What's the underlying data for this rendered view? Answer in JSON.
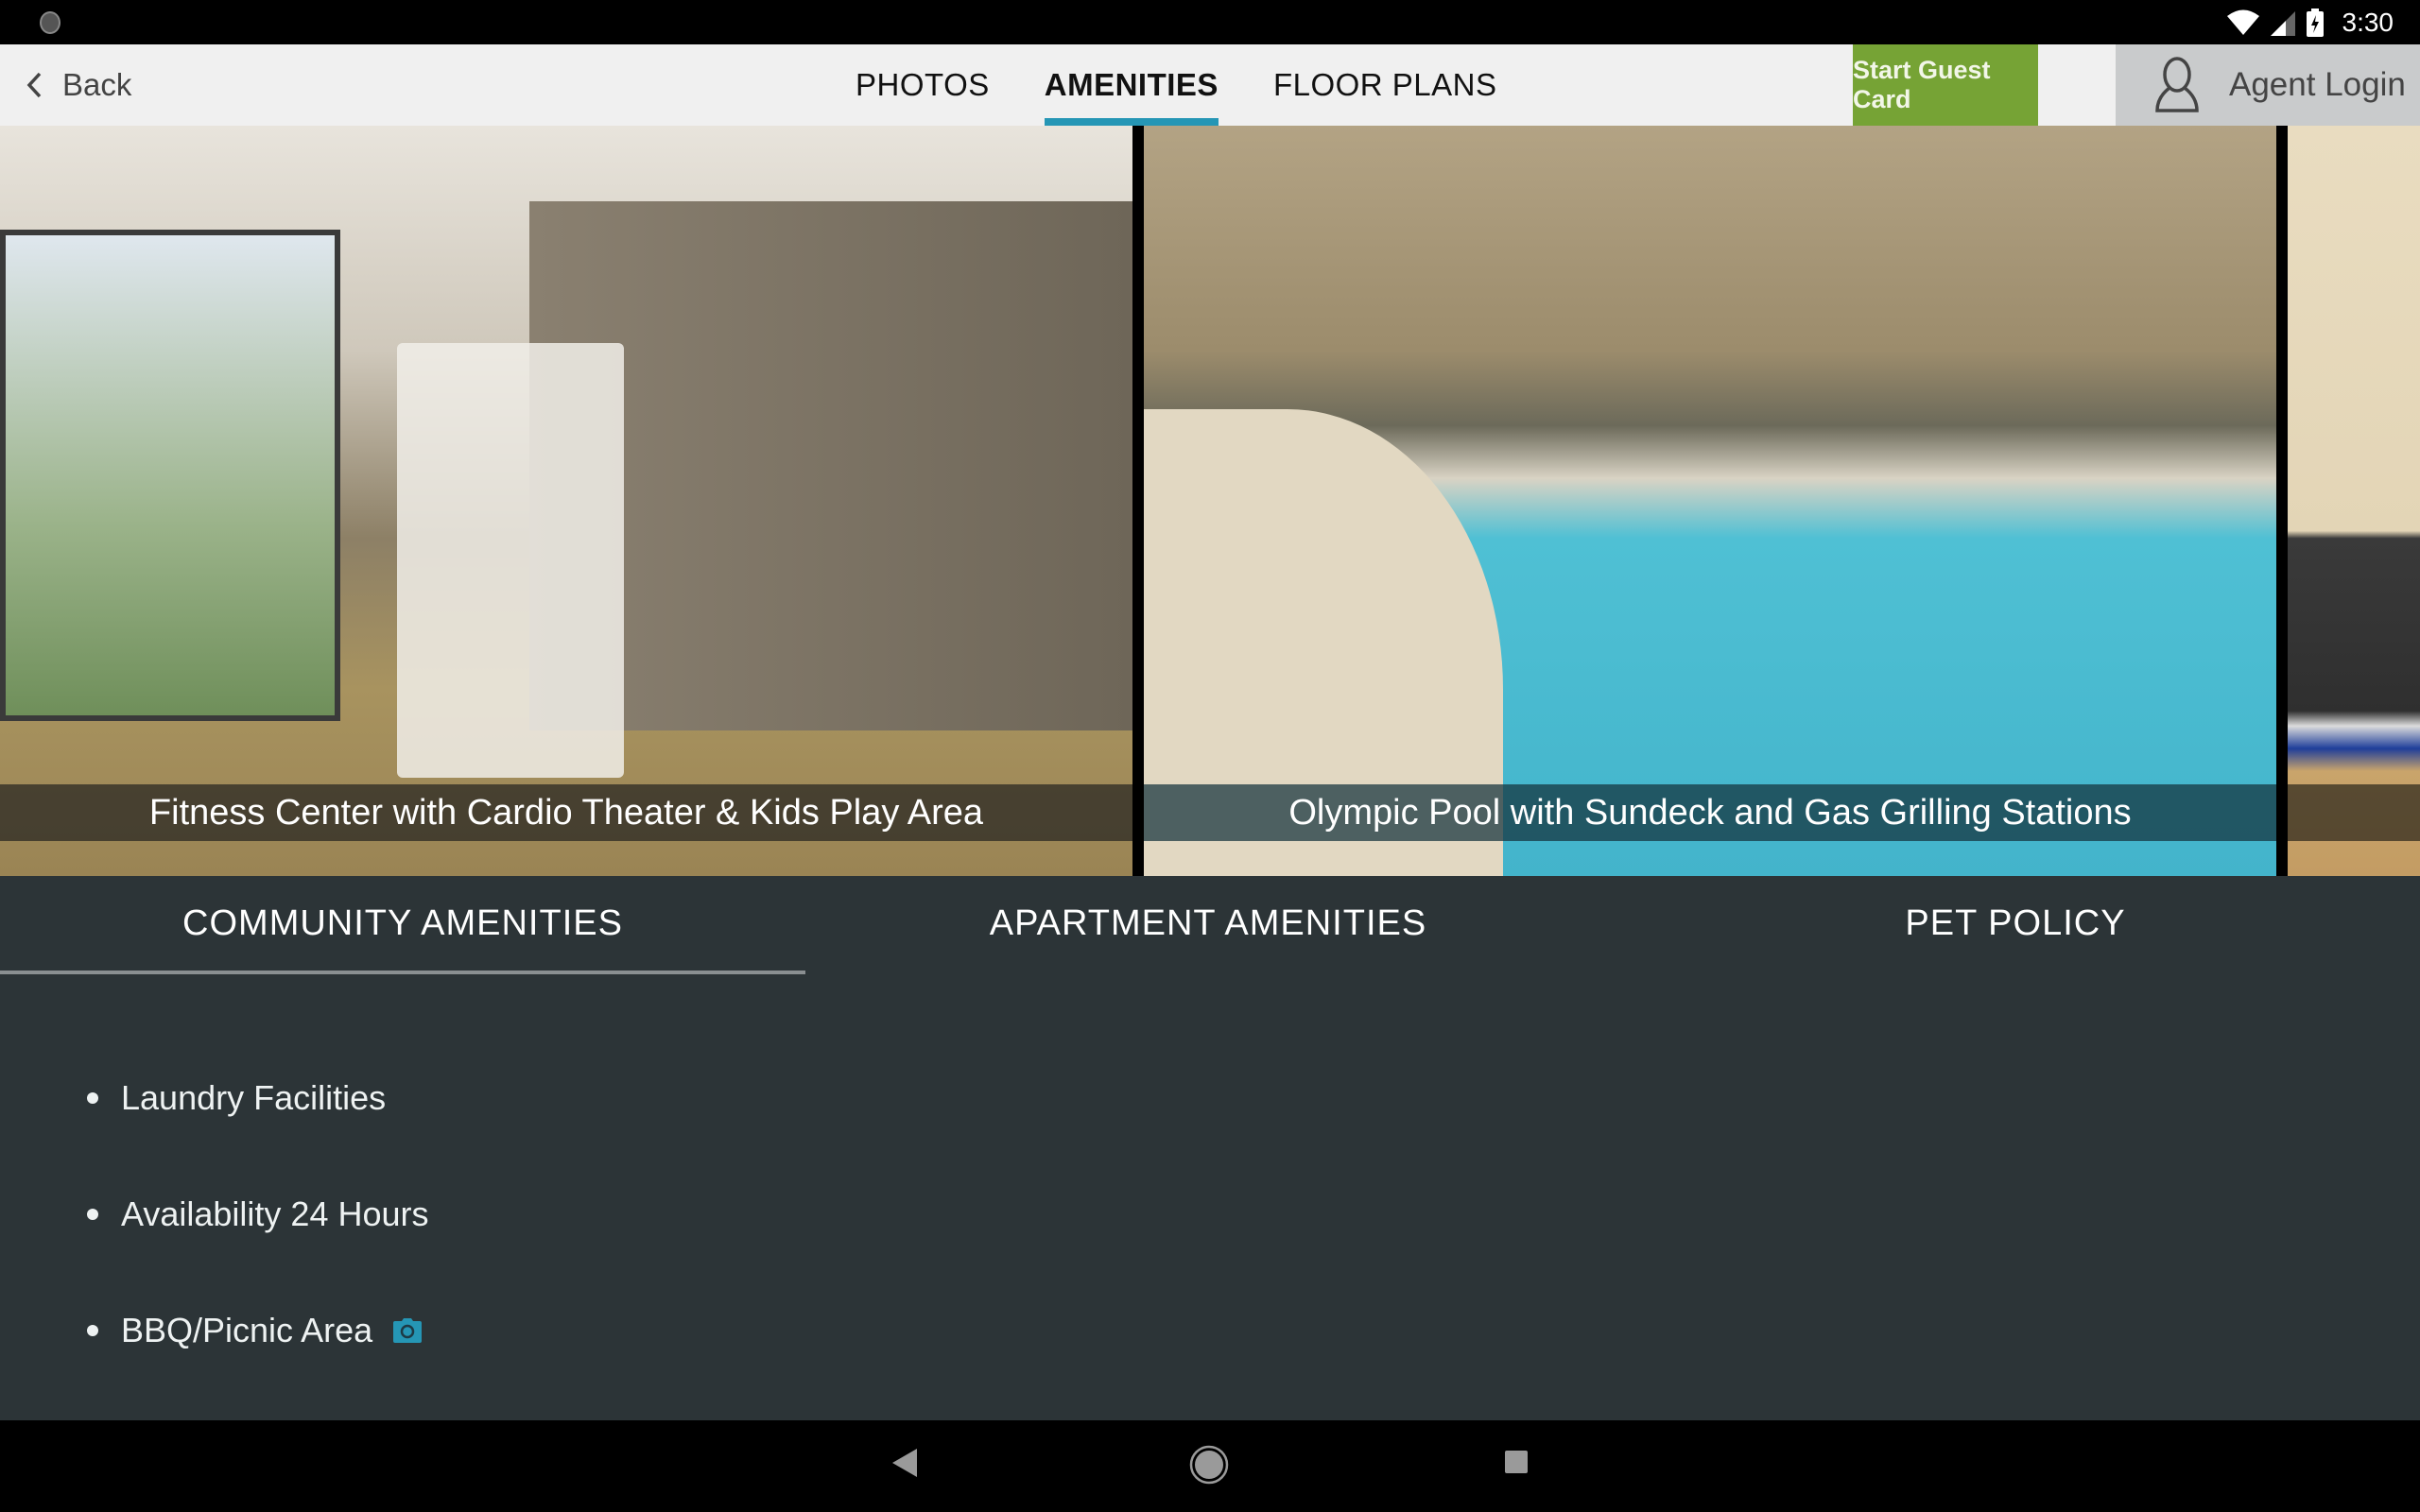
{
  "status_bar": {
    "time": "3:30",
    "icons": [
      "notification-icon",
      "wifi-icon",
      "cell-signal-icon",
      "battery-charging-icon"
    ]
  },
  "header": {
    "back_label": "Back",
    "tabs": [
      {
        "label": "PHOTOS",
        "active": false
      },
      {
        "label": "AMENITIES",
        "active": true
      },
      {
        "label": "FLOOR PLANS",
        "active": false
      }
    ],
    "guest_card_label": "Start Guest Card",
    "agent_login_label": "Agent Login"
  },
  "colors": {
    "accent": "#2596b5",
    "guest_button": "#76a335",
    "panel_background": "#2c3437"
  },
  "photos": [
    {
      "caption": "Fitness Center with Cardio Theater & Kids Play Area"
    },
    {
      "caption": "Olympic  Pool with Sundeck and Gas Grilling Stations"
    },
    {
      "caption": ""
    }
  ],
  "amenity_tabs": [
    {
      "label": "COMMUNITY AMENITIES",
      "active": true
    },
    {
      "label": "APARTMENT AMENITIES",
      "active": false
    },
    {
      "label": "PET POLICY",
      "active": false
    }
  ],
  "community_amenities": [
    {
      "label": "Laundry Facilities",
      "has_photo": false
    },
    {
      "label": "Availability 24 Hours",
      "has_photo": false
    },
    {
      "label": "BBQ/Picnic Area",
      "has_photo": true
    }
  ],
  "nav_bar": {
    "buttons": [
      "back-icon",
      "home-icon",
      "recents-icon"
    ]
  }
}
